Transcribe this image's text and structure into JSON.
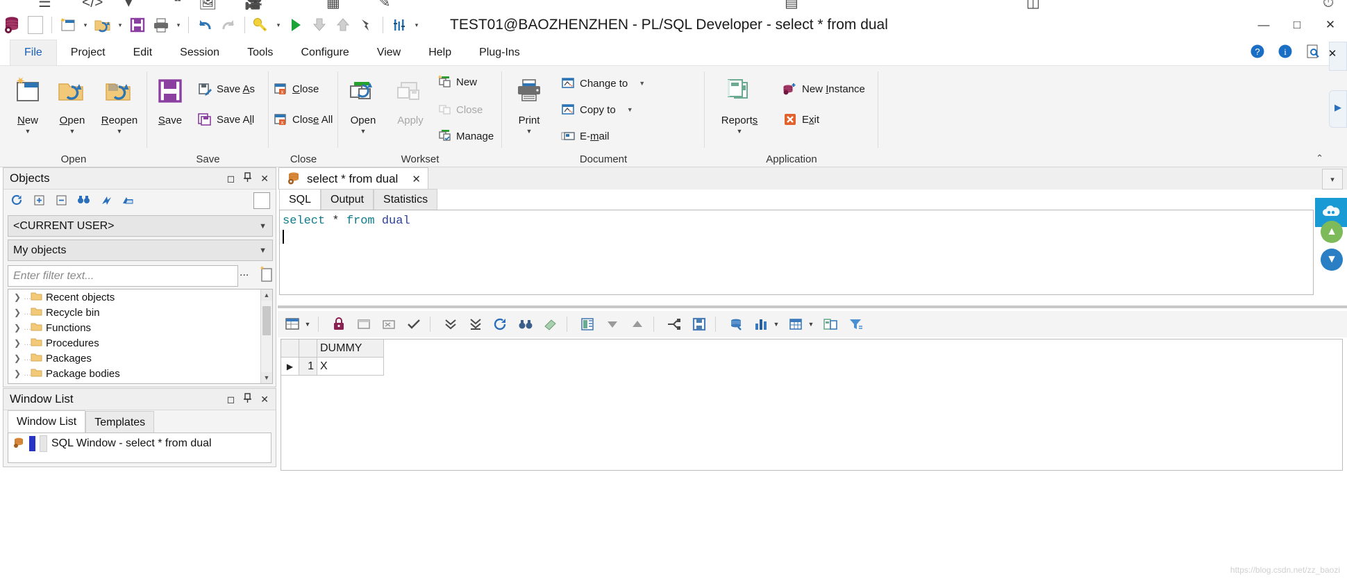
{
  "window": {
    "title": "TEST01@BAOZHENZHEN - PL/SQL Developer - select * from dual",
    "minimize": "—",
    "maximize": "□",
    "close": "✕"
  },
  "quick_access": {
    "items": [
      {
        "name": "database-icon",
        "glyph": "⛃"
      },
      {
        "name": "blank-doc-icon",
        "glyph": "⬜"
      },
      {
        "name": "new-icon",
        "glyph": "὜b"
      },
      {
        "name": "open-icon",
        "glyph": "Ὄ2"
      },
      {
        "name": "save-icon",
        "glyph": "Ὃe"
      },
      {
        "name": "print-icon",
        "glyph": "὚8"
      },
      {
        "name": "undo-icon",
        "glyph": "↩"
      },
      {
        "name": "redo-icon",
        "glyph": "↪"
      },
      {
        "name": "key-icon",
        "glyph": "ὑ1"
      },
      {
        "name": "execute-icon",
        "glyph": "▶"
      },
      {
        "name": "commit-icon",
        "glyph": "⬇"
      },
      {
        "name": "rollback-icon",
        "glyph": "⬆"
      },
      {
        "name": "break-icon",
        "glyph": "⚡"
      },
      {
        "name": "session-icon",
        "glyph": "‖"
      },
      {
        "name": "qat-overflow-caret",
        "glyph": "▾"
      }
    ]
  },
  "menu": {
    "items": [
      {
        "label": "File",
        "active": true
      },
      {
        "label": "Project",
        "active": false
      },
      {
        "label": "Edit",
        "active": false
      },
      {
        "label": "Session",
        "active": false
      },
      {
        "label": "Tools",
        "active": false
      },
      {
        "label": "Configure",
        "active": false
      },
      {
        "label": "View",
        "active": false
      },
      {
        "label": "Help",
        "active": false
      },
      {
        "label": "Plug-Ins",
        "active": false
      }
    ],
    "right_icons": [
      {
        "name": "help-circle-icon",
        "glyph": "?"
      },
      {
        "name": "info-circle-icon",
        "glyph": "i"
      },
      {
        "name": "find-page-icon",
        "glyph": "ὐe"
      }
    ]
  },
  "ribbon": {
    "collapse_glyph": "⌃",
    "groups": [
      {
        "name": "open",
        "label": "Open",
        "big_buttons": [
          {
            "label": "New",
            "underline": "N",
            "has_dropdown": true,
            "disabled": false,
            "icon": "new-document-icon"
          },
          {
            "label": "Open",
            "underline": "O",
            "has_dropdown": true,
            "disabled": false,
            "icon": "open-folder-icon"
          },
          {
            "label": "Reopen",
            "underline": "R",
            "has_dropdown": true,
            "disabled": false,
            "icon": "reopen-folder-icon"
          }
        ]
      },
      {
        "name": "save",
        "label": "Save",
        "big_buttons": [
          {
            "label": "Save",
            "underline": "S",
            "has_dropdown": false,
            "disabled": false,
            "icon": "save-diskette-icon"
          }
        ],
        "small_buttons": [
          {
            "label": "Save As",
            "disabled": false,
            "icon": "save-as-icon"
          },
          {
            "label": "Save All",
            "disabled": false,
            "icon": "save-all-icon"
          }
        ]
      },
      {
        "name": "close",
        "label": "Close",
        "small_buttons": [
          {
            "label": "Close",
            "disabled": false,
            "icon": "close-window-icon"
          },
          {
            "label": "Close All",
            "disabled": false,
            "icon": "close-all-windows-icon"
          }
        ]
      },
      {
        "name": "workset",
        "label": "Workset",
        "big_buttons": [
          {
            "label": "Open",
            "underline": "",
            "has_dropdown": true,
            "disabled": false,
            "icon": "workset-open-icon"
          },
          {
            "label": "Apply",
            "underline": "",
            "has_dropdown": false,
            "disabled": true,
            "icon": "workset-apply-icon"
          }
        ],
        "small_buttons": [
          {
            "label": "New",
            "disabled": false,
            "icon": "workset-new-icon"
          },
          {
            "label": "Close",
            "disabled": true,
            "icon": "workset-close-icon"
          },
          {
            "label": "Manage",
            "disabled": false,
            "icon": "workset-manage-icon"
          }
        ]
      },
      {
        "name": "document",
        "label": "Document",
        "big_buttons": [
          {
            "label": "Print",
            "underline": "",
            "has_dropdown": true,
            "disabled": false,
            "icon": "printer-icon"
          }
        ],
        "small_buttons": [
          {
            "label": "Change to",
            "disabled": false,
            "icon": "change-to-icon",
            "has_dropdown": true
          },
          {
            "label": "Copy to",
            "disabled": false,
            "icon": "copy-to-icon",
            "has_dropdown": true
          },
          {
            "label": "E-mail",
            "disabled": false,
            "icon": "email-icon",
            "has_dropdown": false
          }
        ]
      },
      {
        "name": "application",
        "label": "Application",
        "big_buttons": [
          {
            "label": "Reports",
            "underline": "s",
            "has_dropdown": true,
            "disabled": false,
            "icon": "reports-icon"
          }
        ],
        "small_buttons": [
          {
            "label": "New Instance",
            "disabled": false,
            "icon": "new-instance-icon"
          },
          {
            "label": "Exit",
            "disabled": false,
            "icon": "exit-icon"
          }
        ]
      }
    ]
  },
  "objects_panel": {
    "title": "Objects",
    "controls": [
      {
        "name": "maximize-panel-icon",
        "glyph": "□"
      },
      {
        "name": "pin-panel-icon",
        "glyph": "Ὄc"
      },
      {
        "name": "close-panel-icon",
        "glyph": "✕"
      }
    ],
    "toolbar_icons": [
      {
        "name": "refresh-icon",
        "glyph": "⟳"
      },
      {
        "name": "expand-all-icon",
        "glyph": "+"
      },
      {
        "name": "collapse-all-icon",
        "glyph": "−"
      },
      {
        "name": "find-objects-icon",
        "glyph": "ὐd"
      },
      {
        "name": "browser-filter-icon",
        "glyph": "⤴"
      },
      {
        "name": "browser-folder-icon",
        "glyph": "὜0"
      }
    ],
    "user_selector": "<CURRENT USER>",
    "scope_selector": "My objects",
    "filter_placeholder": "Enter filter text...",
    "filter_value": "",
    "filter_more_label": "...",
    "tree_items": [
      "Recent objects",
      "Recycle bin",
      "Functions",
      "Procedures",
      "Packages",
      "Package bodies"
    ]
  },
  "window_list_panel": {
    "title": "Window List",
    "controls": [
      {
        "name": "maximize-panel-icon",
        "glyph": "□"
      },
      {
        "name": "pin-panel-icon",
        "glyph": "Ὄc"
      },
      {
        "name": "close-panel-icon",
        "glyph": "✕"
      }
    ],
    "tabs": [
      {
        "label": "Window List",
        "active": true
      },
      {
        "label": "Templates",
        "active": false
      }
    ],
    "rows": [
      {
        "label": "SQL Window - select * from dual"
      }
    ]
  },
  "document": {
    "tab_label": "select * from dual",
    "tab_close_glyph": "✕",
    "overflow_glyph": "▾"
  },
  "sql_window": {
    "tabs": [
      {
        "label": "SQL",
        "active": true
      },
      {
        "label": "Output",
        "active": false
      },
      {
        "label": "Statistics",
        "active": false
      }
    ],
    "statement_tokens": [
      {
        "text": "select",
        "type": "keyword"
      },
      {
        "text": " ",
        "type": "plain"
      },
      {
        "text": "*",
        "type": "operator"
      },
      {
        "text": " ",
        "type": "plain"
      },
      {
        "text": "from",
        "type": "keyword"
      },
      {
        "text": " ",
        "type": "plain"
      },
      {
        "text": "dual",
        "type": "identifier"
      }
    ],
    "statement_plain": "select * from dual"
  },
  "grid_toolbar": {
    "icons": [
      {
        "name": "grid-view-icon",
        "glyph": "▤",
        "caret": true
      },
      {
        "name": "lock-icon",
        "glyph": "ὑ2"
      },
      {
        "name": "insert-record-icon",
        "glyph": "⬚"
      },
      {
        "name": "delete-record-icon",
        "glyph": "⌧"
      },
      {
        "name": "post-changes-icon",
        "glyph": "✔"
      },
      {
        "name": "fetch-next-page-icon",
        "glyph": "⤓"
      },
      {
        "name": "fetch-last-page-icon",
        "glyph": "⤓"
      },
      {
        "name": "refresh-data-icon",
        "glyph": "⟳"
      },
      {
        "name": "find-data-icon",
        "glyph": "ὐd"
      },
      {
        "name": "clear-filter-icon",
        "glyph": "⌫"
      },
      {
        "name": "export-data-icon",
        "glyph": "Ὄ4",
        "caret": false
      },
      {
        "name": "sort-descending-icon",
        "glyph": "▼"
      },
      {
        "name": "sort-ascending-icon",
        "glyph": "▲"
      },
      {
        "name": "split-columns-icon",
        "glyph": "⇶"
      },
      {
        "name": "save-dataset-icon",
        "glyph": "Ὃe"
      },
      {
        "name": "link-query-icon",
        "glyph": "ὑ7"
      },
      {
        "name": "chart-icon",
        "glyph": "Ὄa",
        "caret": true
      },
      {
        "name": "table-layout-icon",
        "glyph": "▦",
        "caret": true
      },
      {
        "name": "report-grid-icon",
        "glyph": "὜3"
      },
      {
        "name": "filter-icon",
        "glyph": "⚗"
      }
    ]
  },
  "result_grid": {
    "columns": [
      "DUMMY"
    ],
    "rows": [
      {
        "row_number": "1",
        "indicator": "▶",
        "cells": [
          "X"
        ]
      }
    ]
  },
  "right_rail": {
    "close_glyph": "✕",
    "badge_glyph": "☁",
    "up_glyph": "▲",
    "down_glyph": "▼"
  },
  "watermark": "https://blog.csdn.net/zz_baozi",
  "colors": {
    "accent_blue": "#1a5fb4",
    "keyword_teal": "#0f7b8a",
    "identifier_blue": "#2b3fa0",
    "ribbon_bg": "#f4f4f4",
    "panel_border": "#c8c8c8",
    "badge_blue": "#1a9ad4",
    "save_purple": "#8b3fa0",
    "exit_orange": "#e1622c"
  }
}
